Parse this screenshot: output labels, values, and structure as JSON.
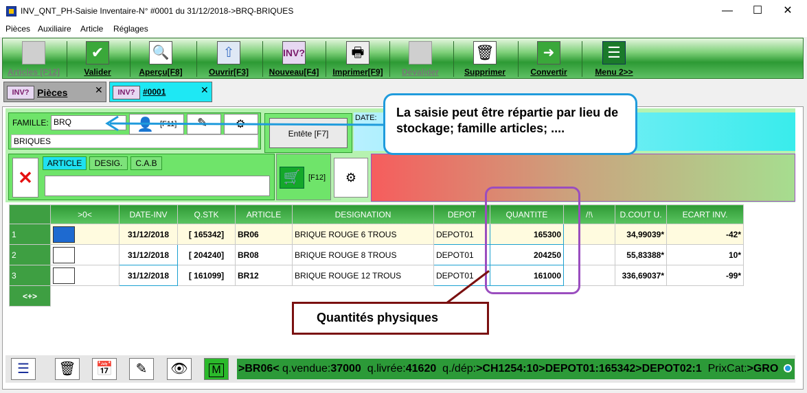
{
  "window": {
    "title": "INV_QNT_PH-Saisie Inventaire-N° #0001 du 31/12/2018->BRQ-BRIQUES",
    "minimize": "—",
    "maximize": "☐",
    "close": "✕"
  },
  "menu": [
    "Pièces",
    "Auxiliaire",
    "Article",
    "Réglages"
  ],
  "toolbar": [
    {
      "label": "Articles [F12]",
      "icon": "article-icon",
      "enabled": false
    },
    {
      "label": "Valider",
      "icon": "validate-icon",
      "enabled": true
    },
    {
      "label": "Aperçu[F8]",
      "icon": "preview-icon",
      "enabled": true
    },
    {
      "label": "Ouvrir[F3]",
      "icon": "open-icon",
      "enabled": true
    },
    {
      "label": "Nouveau[F4]",
      "icon": "new-inv-icon",
      "enabled": true
    },
    {
      "label": "Imprimer[F9]",
      "icon": "printer-icon",
      "enabled": true
    },
    {
      "label": "Dévalider",
      "icon": "unvalidate-icon",
      "enabled": false
    },
    {
      "label": "Supprimer",
      "icon": "trash-icon",
      "enabled": true
    },
    {
      "label": "Convertir",
      "icon": "convert-icon",
      "enabled": true
    },
    {
      "label": "Menu 2>>",
      "icon": "menu-icon",
      "enabled": true
    }
  ],
  "tabs": [
    {
      "label": "Pièces",
      "icon_text": "INV?"
    },
    {
      "label": "#0001",
      "icon_text": "INV?"
    }
  ],
  "header": {
    "famille_label": "FAMILLE:",
    "famille_value": "BRQ",
    "famille_name": "BRIQUES",
    "f11": "[F11]",
    "entete_button": "Entête [F7]",
    "date_label": "DATE:",
    "search_tabs": [
      "ARTICLE",
      "DESIG.",
      "C.A.B"
    ],
    "search_value": "",
    "f12": "[F12]"
  },
  "grid": {
    "columns": [
      ">0<",
      "DATE-INV",
      "Q.STK",
      "ARTICLE",
      "DESIGNATION",
      "DEPOT",
      "QUANTITE",
      "/!\\",
      "D.COUT U.",
      "ECART INV."
    ],
    "rows": [
      {
        "num": "1",
        "date": "31/12/2018",
        "qstk": "[ 165342]",
        "article": "BR06",
        "designation": "BRIQUE ROUGE 6 TROUS",
        "depot": "DEPOT01",
        "quantite": "165300",
        "warn": "",
        "cout": "34,99039*",
        "ecart": "-42*"
      },
      {
        "num": "2",
        "date": "31/12/2018",
        "qstk": "[ 204240]",
        "article": "BR08",
        "designation": "BRIQUE ROUGE 8 TROUS",
        "depot": "DEPOT01",
        "quantite": "204250",
        "warn": "",
        "cout": "55,83388*",
        "ecart": "10*"
      },
      {
        "num": "3",
        "date": "31/12/2018",
        "qstk": "[ 161099]",
        "article": "BR12",
        "designation": "BRIQUE ROUGE 12 TROUS",
        "depot": "DEPOT01",
        "quantite": "161000",
        "warn": "",
        "cout": "336,69037*",
        "ecart": "-99*"
      }
    ],
    "add_row": "<+>"
  },
  "callouts": {
    "blue": "La saisie peut être répartie par lieu de stockage; famille articles; ....",
    "red": "Quantités physiques"
  },
  "status": {
    "article": ">BR06<",
    "vendue_label": "q.vendue:",
    "vendue": "37000",
    "livree_label": "q.livrée:",
    "livree": "41620",
    "dep_label": "q./dép:",
    "dep": ">CH1254:10>DEPOT01:165342>DEPOT02:1",
    "prixcat_label": "PrixCat:",
    "prixcat": ">GRO"
  },
  "colors": {
    "accent_green": "#2d9a34",
    "callout_blue": "#1f9bdc",
    "callout_red": "#7a1010",
    "highlight_purple": "#9a4dbf"
  }
}
